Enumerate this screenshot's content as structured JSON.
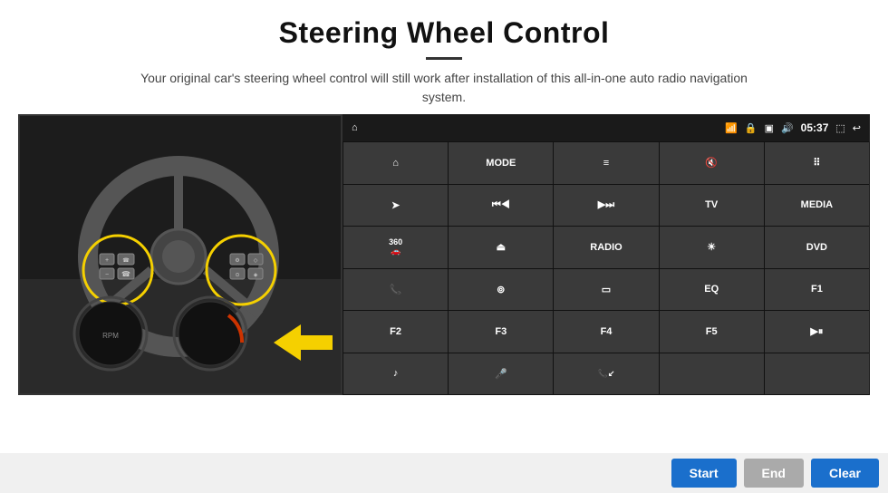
{
  "header": {
    "title": "Steering Wheel Control",
    "subtitle": "Your original car's steering wheel control will still work after installation of this all-in-one auto radio navigation system."
  },
  "status_bar": {
    "wifi_icon": "wifi",
    "lock_icon": "🔒",
    "sim_icon": "📶",
    "bt_icon": "🔵",
    "time": "05:37",
    "signal_icon": "📡",
    "back_icon": "↩"
  },
  "button_grid": [
    {
      "id": "home",
      "label": "⌂",
      "icon": true
    },
    {
      "id": "mode",
      "label": "MODE"
    },
    {
      "id": "list",
      "label": "≡"
    },
    {
      "id": "mute",
      "label": "🔇"
    },
    {
      "id": "apps",
      "label": "⊞"
    },
    {
      "id": "nav",
      "label": "➤"
    },
    {
      "id": "prev",
      "label": "⏮"
    },
    {
      "id": "next",
      "label": "⏭"
    },
    {
      "id": "tv",
      "label": "TV"
    },
    {
      "id": "media",
      "label": "MEDIA"
    },
    {
      "id": "360",
      "label": "360"
    },
    {
      "id": "eject",
      "label": "⏏"
    },
    {
      "id": "radio",
      "label": "RADIO"
    },
    {
      "id": "bright",
      "label": "☀"
    },
    {
      "id": "dvd",
      "label": "DVD"
    },
    {
      "id": "phone",
      "label": "📞"
    },
    {
      "id": "navi2",
      "label": "⊚"
    },
    {
      "id": "screen",
      "label": "▭"
    },
    {
      "id": "eq",
      "label": "EQ"
    },
    {
      "id": "f1",
      "label": "F1"
    },
    {
      "id": "f2",
      "label": "F2"
    },
    {
      "id": "f3",
      "label": "F3"
    },
    {
      "id": "f4",
      "label": "F4"
    },
    {
      "id": "f5",
      "label": "F5"
    },
    {
      "id": "playpause",
      "label": "▶⏸"
    },
    {
      "id": "music",
      "label": "♪"
    },
    {
      "id": "mic",
      "label": "🎤"
    },
    {
      "id": "call",
      "label": "📞↙"
    },
    {
      "id": "empty1",
      "label": ""
    },
    {
      "id": "empty2",
      "label": ""
    }
  ],
  "bottom_buttons": {
    "start": "Start",
    "end": "End",
    "clear": "Clear"
  },
  "colors": {
    "accent_blue": "#1a6fcc",
    "btn_disabled": "#aaaaaa",
    "panel_bg": "#2a2a2a",
    "statusbar_bg": "#1a1a1a",
    "btn_bg": "#3a3a3a"
  }
}
